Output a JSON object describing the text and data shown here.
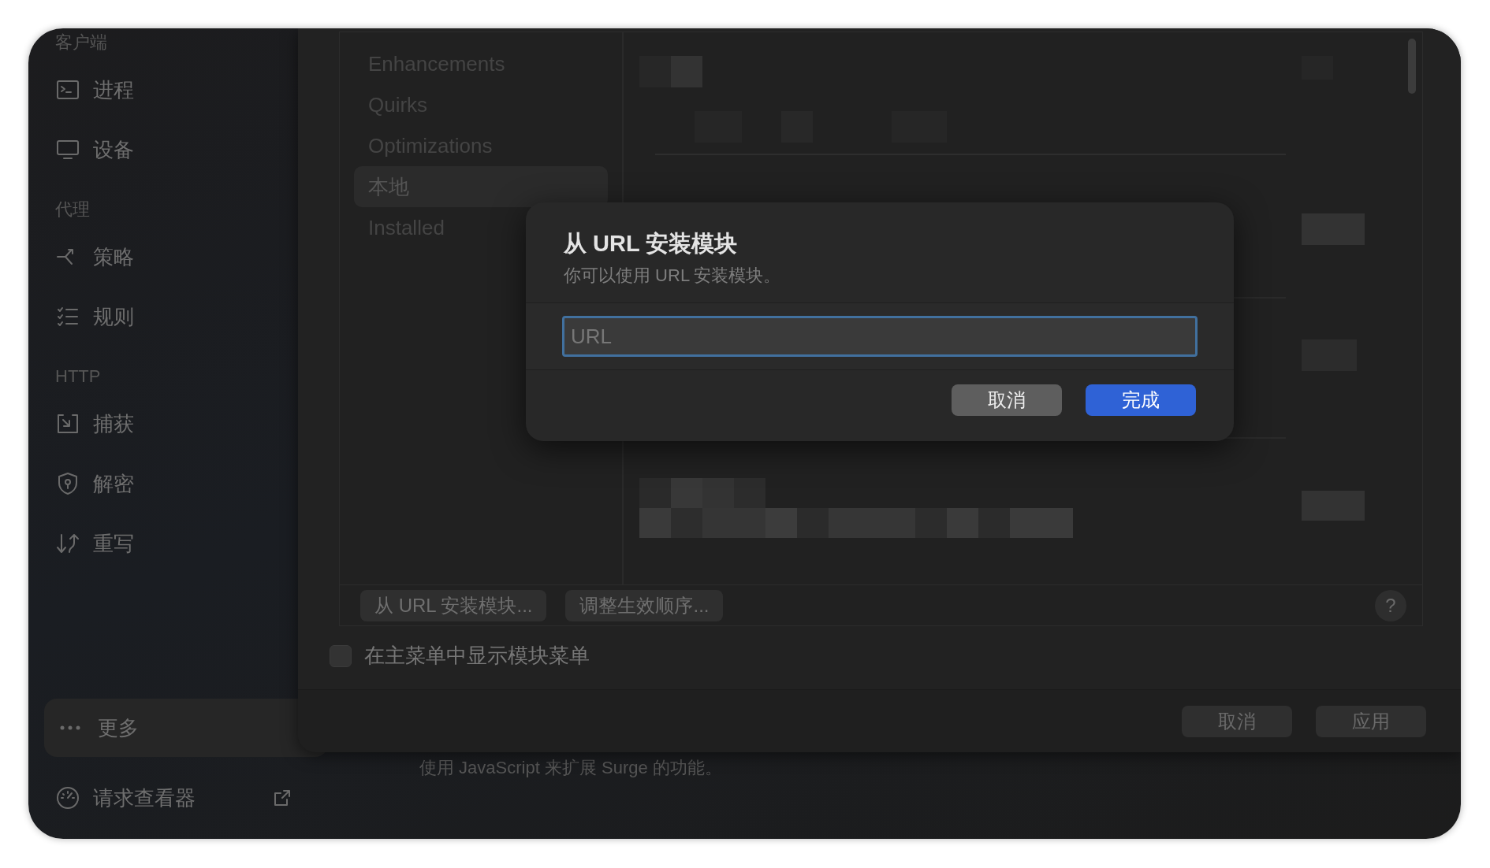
{
  "sidebar": {
    "sections": [
      {
        "header": "客户端",
        "items": [
          {
            "label": "进程"
          },
          {
            "label": "设备"
          }
        ]
      },
      {
        "header": "代理",
        "items": [
          {
            "label": "策略"
          },
          {
            "label": "规则"
          }
        ]
      },
      {
        "header": "HTTP",
        "items": [
          {
            "label": "捕获"
          },
          {
            "label": "解密"
          },
          {
            "label": "重写"
          }
        ]
      }
    ],
    "more": {
      "label": "更多",
      "selected": true
    },
    "footer": {
      "label": "请求查看器"
    }
  },
  "background_text": "使用 JavaScript 来扩展 Surge 的功能。",
  "sheet": {
    "categories": [
      {
        "label": "Enhancements",
        "selected": false
      },
      {
        "label": "Quirks",
        "selected": false
      },
      {
        "label": "Optimizations",
        "selected": false
      },
      {
        "label": "本地",
        "selected": true
      },
      {
        "label": "Installed",
        "selected": false
      }
    ],
    "toolbar_buttons": [
      "从 URL 安装模块...",
      "调整生效顺序..."
    ],
    "help": "?",
    "checkbox": {
      "label": "在主菜单中显示模块菜单",
      "checked": false
    },
    "buttons": [
      "取消",
      "应用"
    ]
  },
  "dialog": {
    "title": "从 URL 安装模块",
    "subtitle": "你可以使用 URL 安装模块。",
    "field": {
      "placeholder": "URL"
    },
    "buttons": [
      {
        "label": "取消",
        "kind": "secondary"
      },
      {
        "label": "完成",
        "kind": "primary"
      }
    ]
  }
}
